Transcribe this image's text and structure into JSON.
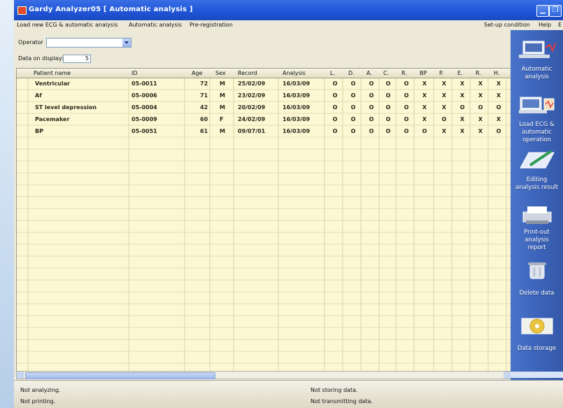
{
  "window": {
    "title": "Gardy Analyzer05 [ Automatic analysis ]"
  },
  "menu": {
    "items": [
      "Load new ECG & automatic analysis",
      "Automatic analysis",
      "Pre-registration"
    ],
    "right_items": [
      "Set-up condition",
      "Help",
      "E"
    ]
  },
  "filters": {
    "operator_label": "Operator",
    "operator_value": "",
    "data_label": "Data on display:",
    "data_value": "5"
  },
  "table": {
    "columns": [
      "Patient name",
      "ID",
      "Age",
      "Sex",
      "Record",
      "Analysis",
      "L.",
      "D.",
      "A.",
      "C.",
      "R.",
      "BP",
      "P.",
      "E.",
      "R.",
      "H."
    ],
    "rows": [
      [
        "Ventricular",
        "05-0011",
        "72",
        "M",
        "25/02/09",
        "16/03/09",
        "O",
        "O",
        "O",
        "O",
        "O",
        "X",
        "X",
        "X",
        "X",
        "X"
      ],
      [
        "Af",
        "05-0006",
        "71",
        "M",
        "23/02/09",
        "16/03/09",
        "O",
        "O",
        "O",
        "O",
        "O",
        "X",
        "X",
        "X",
        "X",
        "X"
      ],
      [
        "ST level depression",
        "05-0004",
        "42",
        "M",
        "20/02/09",
        "16/03/09",
        "O",
        "O",
        "O",
        "O",
        "O",
        "X",
        "X",
        "O",
        "O",
        "O"
      ],
      [
        "Pacemaker",
        "05-0009",
        "60",
        "F",
        "24/02/09",
        "16/03/09",
        "O",
        "O",
        "O",
        "O",
        "O",
        "X",
        "O",
        "X",
        "X",
        "X"
      ],
      [
        "BP",
        "05-0051",
        "61",
        "M",
        "09/07/01",
        "16/03/09",
        "O",
        "O",
        "O",
        "O",
        "O",
        "O",
        "X",
        "X",
        "X",
        "O"
      ]
    ]
  },
  "sidebar": {
    "buttons": [
      {
        "label": "Automatic\nanalysis",
        "icon": "computer-ecg-icon"
      },
      {
        "label": "Load ECG &\nautomatic\noperation",
        "icon": "load-ecg-icon"
      },
      {
        "label": "Editing\nanalysis result",
        "icon": "edit-pen-icon"
      },
      {
        "label": "Print-out\nanalysis\nreport",
        "icon": "printer-icon"
      },
      {
        "label": "Delete data",
        "icon": "trash-icon"
      },
      {
        "label": "Data storage",
        "icon": "disc-icon"
      }
    ]
  },
  "status": {
    "analyzing": "Not analyzing.",
    "printing": "Not printing.",
    "storing": "Not storing data.",
    "transmitting": "Not transmitting data."
  },
  "colors": {
    "titlebar": "#2056d8",
    "grid_background": "#fdf8d4",
    "sidebar": "#3c64bb"
  }
}
